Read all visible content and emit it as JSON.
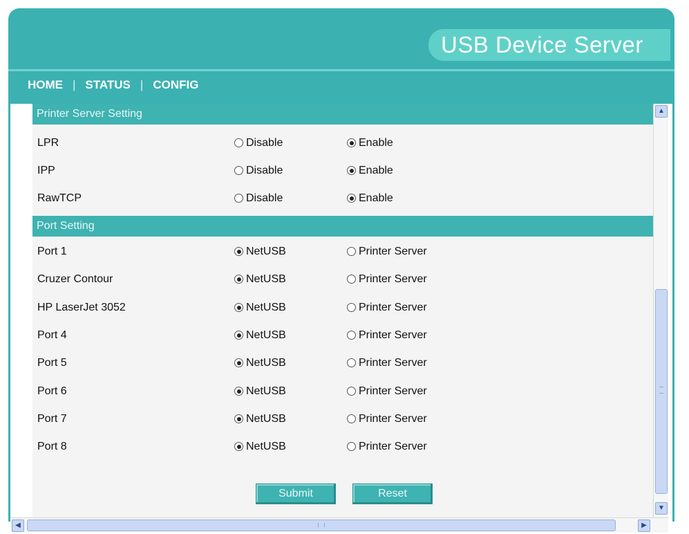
{
  "brand": {
    "title": "USB Device Server"
  },
  "nav": {
    "items": [
      {
        "label": "HOME"
      },
      {
        "label": "STATUS"
      },
      {
        "label": "CONFIG"
      }
    ],
    "separator": "|"
  },
  "printer_section": {
    "title": "Printer Server Setting",
    "option_a": "Disable",
    "option_b": "Enable",
    "rows": [
      {
        "label": "LPR",
        "selected": "Enable"
      },
      {
        "label": "IPP",
        "selected": "Enable"
      },
      {
        "label": "RawTCP",
        "selected": "Enable"
      }
    ]
  },
  "port_section": {
    "title": "Port Setting",
    "option_a": "NetUSB",
    "option_b": "Printer Server",
    "rows": [
      {
        "label": "Port 1",
        "selected": "NetUSB"
      },
      {
        "label": "Cruzer Contour",
        "selected": "NetUSB"
      },
      {
        "label": "HP LaserJet 3052",
        "selected": "NetUSB"
      },
      {
        "label": "Port 4",
        "selected": "NetUSB"
      },
      {
        "label": "Port 5",
        "selected": "NetUSB"
      },
      {
        "label": "Port 6",
        "selected": "NetUSB"
      },
      {
        "label": "Port 7",
        "selected": "NetUSB"
      },
      {
        "label": "Port 8",
        "selected": "NetUSB"
      }
    ]
  },
  "buttons": {
    "submit": "Submit",
    "reset": "Reset"
  },
  "colors": {
    "teal": "#3cb1b1",
    "brand_pill": "#5fd0c8",
    "panel": "#f4f4f4"
  }
}
